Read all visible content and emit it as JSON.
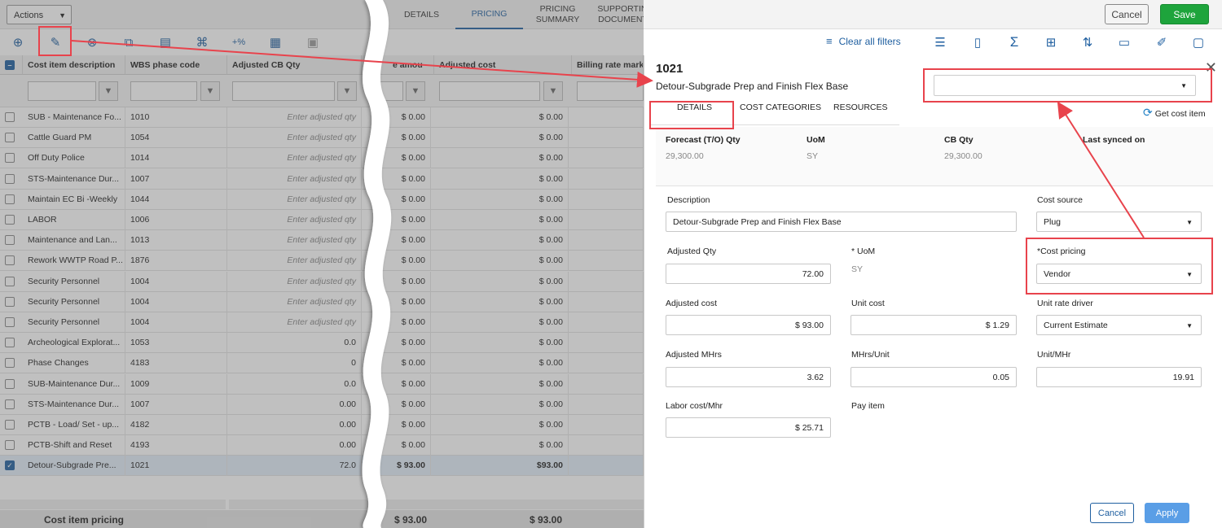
{
  "header": {
    "actions_label": "Actions",
    "tabs": [
      {
        "label": "DETAILS",
        "active": false
      },
      {
        "label": "PRICING",
        "active": true
      },
      {
        "label": "PRICING SUMMARY",
        "active": false
      },
      {
        "label": "SUPPORTING DOCUMENTS",
        "active": false
      }
    ],
    "cancel_label": "Cancel",
    "save_label": "Save",
    "clear_filters_label": "Clear all filters",
    "accent": "#1f5fa0",
    "save_color": "#1ea43c"
  },
  "grid": {
    "columns": [
      "Cost item description",
      "WBS phase code",
      "Adjusted CB Qty",
      "e amou",
      "Adjusted cost",
      "Billing rate markup"
    ],
    "qty_placeholder": "Enter adjusted qty",
    "rows": [
      {
        "desc": "SUB - Maintenance Fo...",
        "code": "1010",
        "qty": "",
        "amount": "$ 0.00",
        "cost": "$ 0.00",
        "selected": false
      },
      {
        "desc": "Cattle Guard PM",
        "code": "1054",
        "qty": "",
        "amount": "$ 0.00",
        "cost": "$ 0.00",
        "selected": false
      },
      {
        "desc": "Off Duty Police",
        "code": "1014",
        "qty": "",
        "amount": "$ 0.00",
        "cost": "$ 0.00",
        "selected": false
      },
      {
        "desc": "STS-Maintenance Dur...",
        "code": "1007",
        "qty": "",
        "amount": "$ 0.00",
        "cost": "$ 0.00",
        "selected": false
      },
      {
        "desc": "Maintain EC Bi -Weekly",
        "code": "1044",
        "qty": "",
        "amount": "$ 0.00",
        "cost": "$ 0.00",
        "selected": false
      },
      {
        "desc": "LABOR",
        "code": "1006",
        "qty": "",
        "amount": "$ 0.00",
        "cost": "$ 0.00",
        "selected": false
      },
      {
        "desc": "Maintenance and Lan...",
        "code": "1013",
        "qty": "",
        "amount": "$ 0.00",
        "cost": "$ 0.00",
        "selected": false
      },
      {
        "desc": "Rework WWTP Road P...",
        "code": "1876",
        "qty": "",
        "amount": "$ 0.00",
        "cost": "$ 0.00",
        "selected": false
      },
      {
        "desc": "Security Personnel",
        "code": "1004",
        "qty": "",
        "amount": "$ 0.00",
        "cost": "$ 0.00",
        "selected": false
      },
      {
        "desc": "Security Personnel",
        "code": "1004",
        "qty": "",
        "amount": "$ 0.00",
        "cost": "$ 0.00",
        "selected": false
      },
      {
        "desc": "Security Personnel",
        "code": "1004",
        "qty": "",
        "amount": "$ 0.00",
        "cost": "$ 0.00",
        "selected": false
      },
      {
        "desc": "Archeological Explorat...",
        "code": "1053",
        "qty": "0.0",
        "amount": "$ 0.00",
        "cost": "$ 0.00",
        "selected": false
      },
      {
        "desc": "Phase Changes",
        "code": "4183",
        "qty": "0",
        "amount": "$ 0.00",
        "cost": "$ 0.00",
        "selected": false
      },
      {
        "desc": "SUB-Maintenance Dur...",
        "code": "1009",
        "qty": "0.0",
        "amount": "$ 0.00",
        "cost": "$ 0.00",
        "selected": false
      },
      {
        "desc": "STS-Maintenance Dur...",
        "code": "1007",
        "qty": "0.00",
        "amount": "$ 0.00",
        "cost": "$ 0.00",
        "selected": false
      },
      {
        "desc": "PCTB - Load/ Set - up...",
        "code": "4182",
        "qty": "0.00",
        "amount": "$ 0.00",
        "cost": "$ 0.00",
        "selected": false
      },
      {
        "desc": "PCTB-Shift and Reset",
        "code": "4193",
        "qty": "0.00",
        "amount": "$ 0.00",
        "cost": "$ 0.00",
        "selected": false
      },
      {
        "desc": "Detour-Subgrade Pre...",
        "code": "1021",
        "qty": "72.0",
        "amount": "$ 93.00",
        "cost": "$93.00",
        "selected": true
      }
    ],
    "footer": {
      "label": "Cost item pricing",
      "amount": "$ 93.00",
      "cost": "$ 93.00"
    }
  },
  "panel": {
    "code": "1021",
    "title": "Detour-Subgrade Prep and Finish Flex Base",
    "tabs": [
      "DETAILS",
      "COST CATEGORIES",
      "RESOURCES"
    ],
    "get_cost_item": "Get cost item",
    "summary": [
      {
        "label": "Forecast (T/O) Qty",
        "value": "29,300.00"
      },
      {
        "label": "UoM",
        "value": "SY"
      },
      {
        "label": "CB Qty",
        "value": "29,300.00"
      },
      {
        "label": "Last synced on",
        "value": ""
      }
    ],
    "description_label": "Description",
    "description_value": "Detour-Subgrade Prep and Finish Flex Base",
    "cost_source_label": "Cost source",
    "cost_source_value": "Plug",
    "adjusted_qty_label": "Adjusted Qty",
    "adjusted_qty_value": "72.00",
    "uom_label": "* UoM",
    "uom_value": "SY",
    "cost_pricing_label": "*Cost pricing",
    "cost_pricing_value": "Vendor",
    "adjusted_cost_label": "Adjusted cost",
    "adjusted_cost_value": "$ 93.00",
    "unit_cost_label": "Unit cost",
    "unit_cost_value": "$ 1.29",
    "unit_rate_driver_label": "Unit rate driver",
    "unit_rate_driver_value": "Current Estimate",
    "adjusted_mhrs_label": "Adjusted MHrs",
    "adjusted_mhrs_value": "3.62",
    "mhrs_unit_label": "MHrs/Unit",
    "mhrs_unit_value": "0.05",
    "unit_mhr_label": "Unit/MHr",
    "unit_mhr_value": "19.91",
    "labor_cost_label": "Labor cost/Mhr",
    "labor_cost_value": "$ 25.71",
    "pay_item_label": "Pay item",
    "cancel_label": "Cancel",
    "apply_label": "Apply",
    "highlight_color": "#e8434c"
  }
}
